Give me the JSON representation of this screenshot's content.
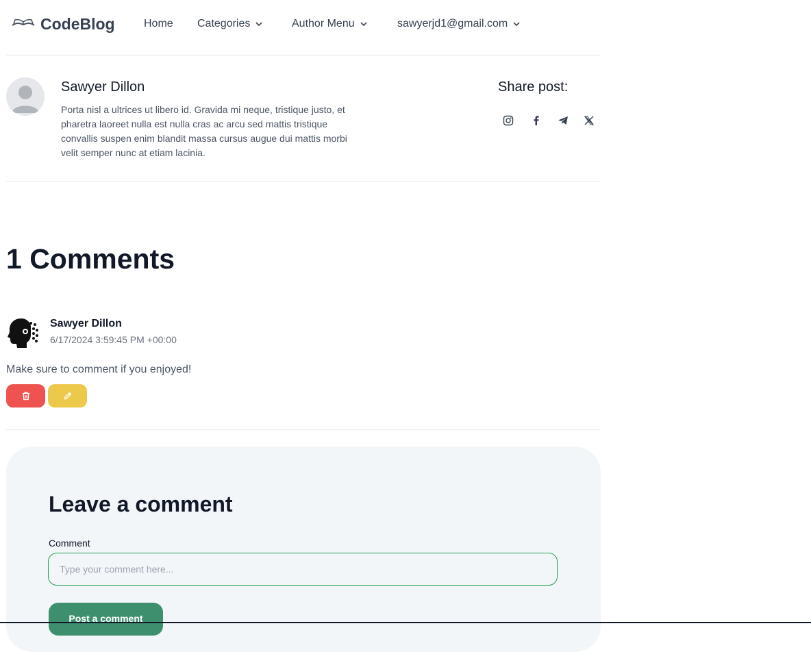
{
  "header": {
    "logo_text": "CodeBlog",
    "logo_icon": "open-book-icon",
    "nav": {
      "home": "Home",
      "categories": "Categories",
      "author_menu": "Author Menu",
      "account": "sawyerjd1@gmail.com"
    }
  },
  "author": {
    "name": "Sawyer Dillon",
    "bio": "Porta nisl a ultrices ut libero id. Gravida mi neque, tristique justo, et pharetra laoreet nulla est nulla cras ac arcu sed mattis tristique convallis suspen enim blandit massa cursus augue dui mattis morbi velit semper nunc at etiam lacinia.",
    "share_title": "Share post:",
    "share_icons": [
      "instagram-icon",
      "facebook-icon",
      "telegram-icon",
      "x-icon"
    ]
  },
  "comments": {
    "title": "1 Comments",
    "items": [
      {
        "author": "Sawyer Dillon",
        "date": "6/17/2024 3:59:45 PM +00:00",
        "text": "Make sure to comment if you enjoyed!"
      }
    ]
  },
  "form": {
    "title": "Leave a comment",
    "label": "Comment",
    "placeholder": "Type your comment here...",
    "submit_label": "Post a comment"
  },
  "colors": {
    "delete": "#ef5350",
    "edit": "#ecc94b",
    "submit": "#3d8f6e",
    "input_border": "#22a052",
    "form_bg": "#f3f6f9"
  }
}
